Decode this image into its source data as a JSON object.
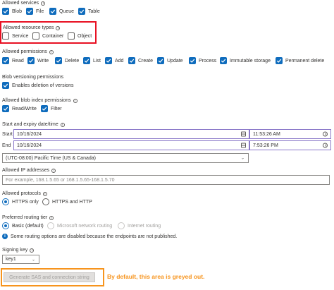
{
  "services": {
    "label": "Allowed services",
    "items": [
      {
        "label": "Blob",
        "checked": true
      },
      {
        "label": "File",
        "checked": true
      },
      {
        "label": "Queue",
        "checked": true
      },
      {
        "label": "Table",
        "checked": true
      }
    ]
  },
  "resource_types": {
    "label": "Allowed resource types",
    "items": [
      {
        "label": "Service",
        "checked": false
      },
      {
        "label": "Container",
        "checked": false
      },
      {
        "label": "Object",
        "checked": false
      }
    ]
  },
  "permissions": {
    "label": "Allowed permissions",
    "items": [
      {
        "label": "Read",
        "checked": true
      },
      {
        "label": "Write",
        "checked": true
      },
      {
        "label": "Delete",
        "checked": true
      },
      {
        "label": "List",
        "checked": true
      },
      {
        "label": "Add",
        "checked": true
      },
      {
        "label": "Create",
        "checked": true
      },
      {
        "label": "Update",
        "checked": true
      },
      {
        "label": "Process",
        "checked": true
      },
      {
        "label": "Immutable storage",
        "checked": true
      },
      {
        "label": "Permanent delete",
        "checked": true
      }
    ]
  },
  "versioning": {
    "label": "Blob versioning permissions",
    "items": [
      {
        "label": "Enables deletion of versions",
        "checked": true
      }
    ]
  },
  "index": {
    "label": "Allowed blob index permissions",
    "items": [
      {
        "label": "Read/Write",
        "checked": true
      },
      {
        "label": "Filter",
        "checked": true
      }
    ]
  },
  "expiry": {
    "label": "Start and expiry date/time",
    "start_label": "Start",
    "end_label": "End",
    "start_date": "10/16/2024",
    "start_time": "11:53:26 AM",
    "end_date": "10/16/2024",
    "end_time": "7:53:26 PM",
    "timezone": "(UTC-08:00) Pacific Time (US & Canada)"
  },
  "ip": {
    "label": "Allowed IP addresses",
    "placeholder": "For example, 168.1.5.65 or 168.1.5.65-168.1.5.70"
  },
  "protocols": {
    "label": "Allowed protocols",
    "options": [
      {
        "label": "HTTPS only",
        "selected": true
      },
      {
        "label": "HTTPS and HTTP",
        "selected": false
      }
    ]
  },
  "routing": {
    "label": "Preferred routing tier",
    "options": [
      {
        "label": "Basic (default)",
        "selected": true
      },
      {
        "label": "Microsoft network routing",
        "selected": false
      },
      {
        "label": "Internet routing",
        "selected": false
      }
    ],
    "info": "Some routing options are disabled because the endpoints are not published."
  },
  "signing": {
    "label": "Signing key",
    "value": "key1"
  },
  "generate_button": "Generate SAS and connection string",
  "note": "By default, this area is greyed out.",
  "colors": {
    "accent": "#0f6cbd",
    "highlight_red": "#e81123",
    "highlight_orange": "#f7941d"
  }
}
